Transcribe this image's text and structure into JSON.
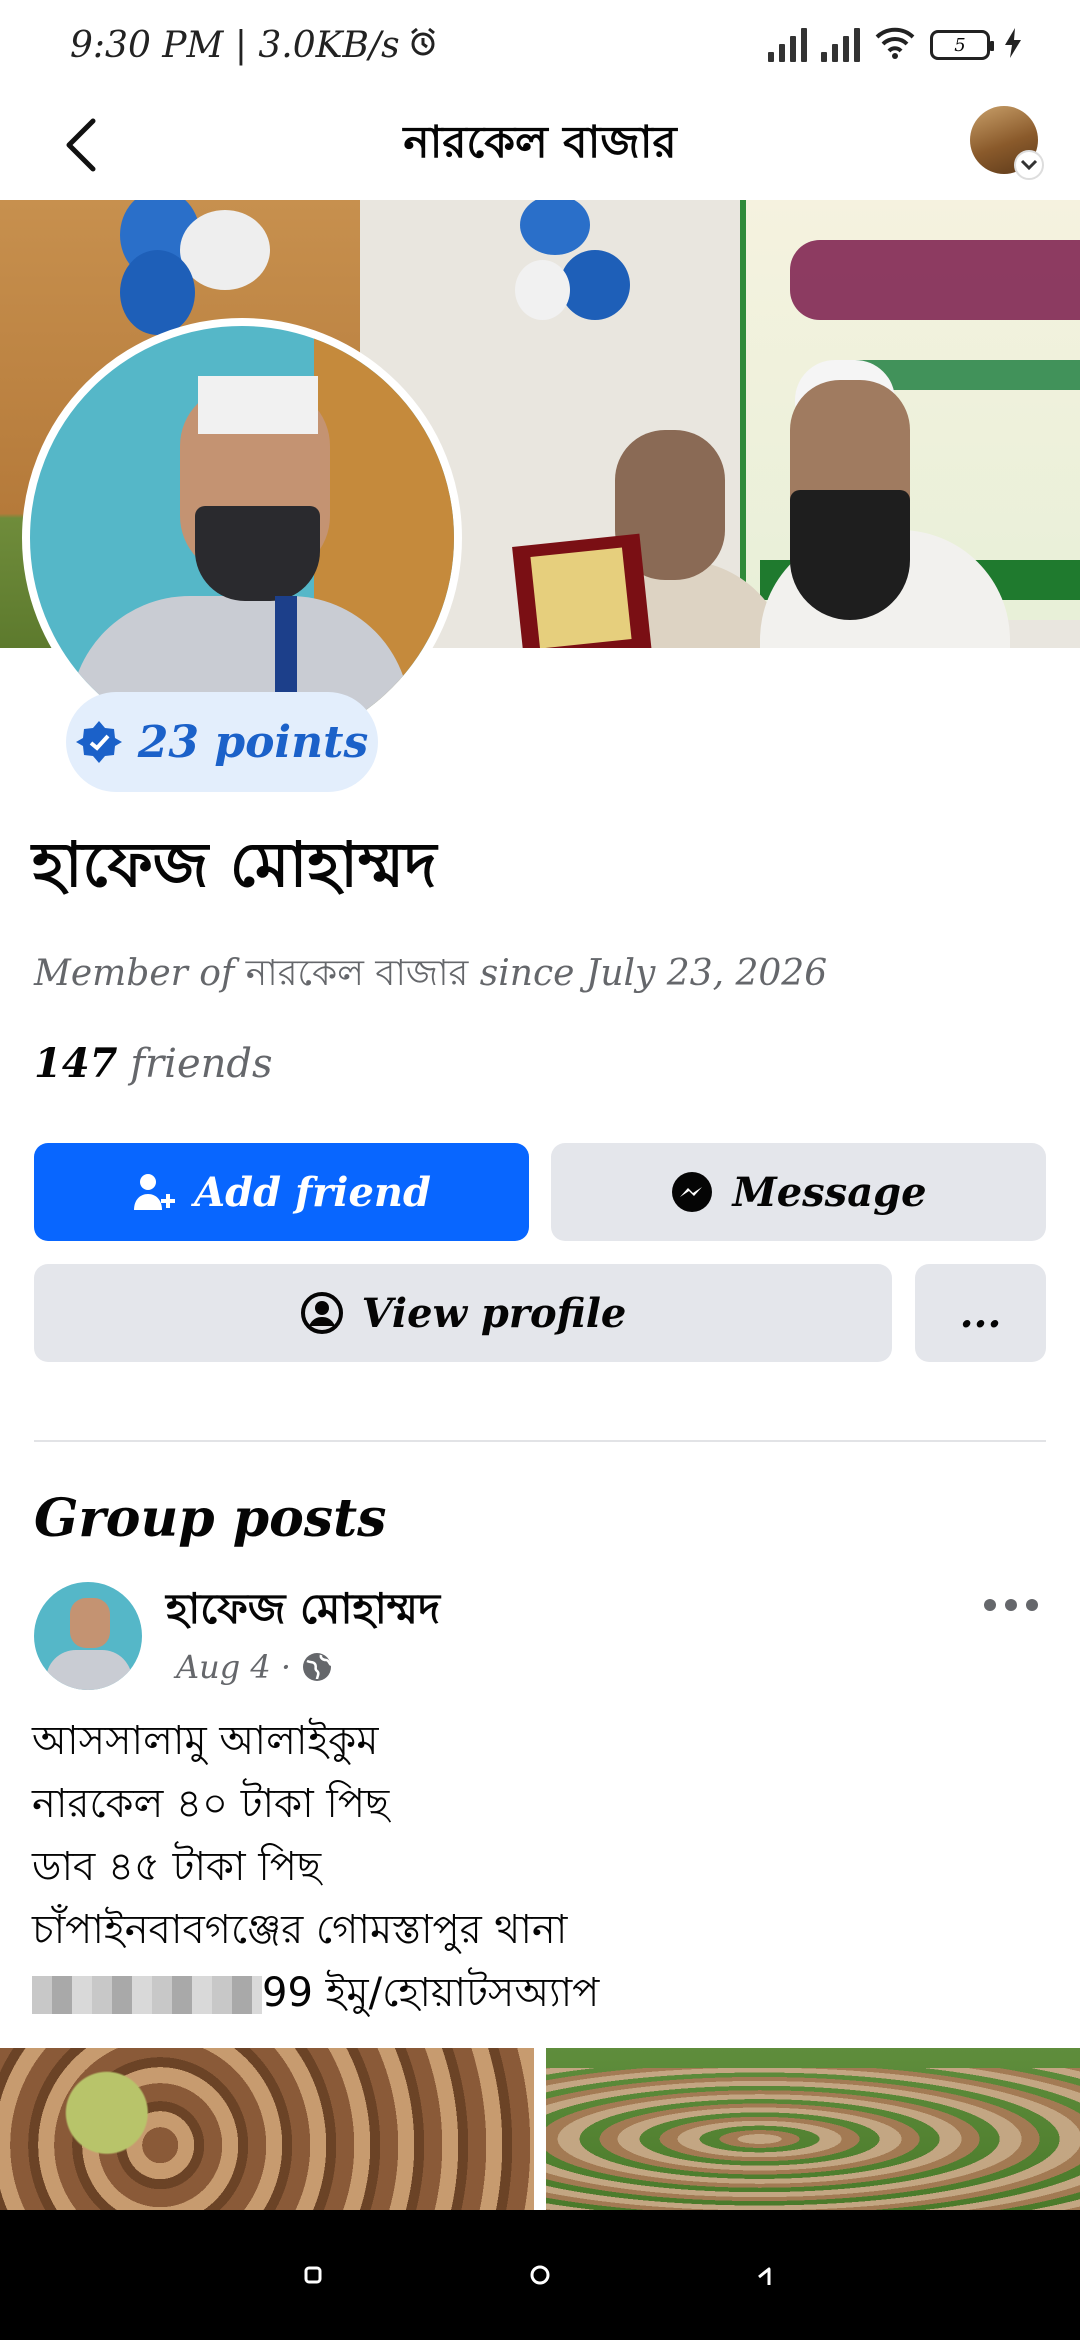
{
  "status_bar": {
    "time_speed": "9:30 PM | 3.0KB/s",
    "battery_level": "5"
  },
  "header": {
    "title": "নারকেল বাজার"
  },
  "profile": {
    "points_label": "23 points",
    "name": "হাফেজ মোহাম্মদ",
    "member_prefix": "Member of",
    "member_group": "নারকেল বাজার",
    "member_suffix": "since July 23, 2026",
    "friends_count": "147",
    "friends_label": "friends"
  },
  "actions": {
    "add_friend": "Add friend",
    "message": "Message",
    "view_profile": "View profile",
    "more": "..."
  },
  "posts_section": {
    "title": "Group posts"
  },
  "post": {
    "author": "হাফেজ মোহাম্মদ",
    "date": "Aug 4 ·",
    "lines": [
      "আসসালামু আলাইকুম",
      "নারকেল ৪০ টাকা পিছ",
      "ডাব ৪৫ টাকা পিছ",
      "চাঁপাইনবাবগঞ্জের গোমস্তাপুর থানা"
    ],
    "phone_suffix": "99 ইমু/হোয়াটসঅ্যাপ"
  },
  "colors": {
    "accent_blue": "#0866ff",
    "points_text": "#1b61c9",
    "button_gray": "#e4e6eb",
    "secondary_text": "#65676b"
  }
}
